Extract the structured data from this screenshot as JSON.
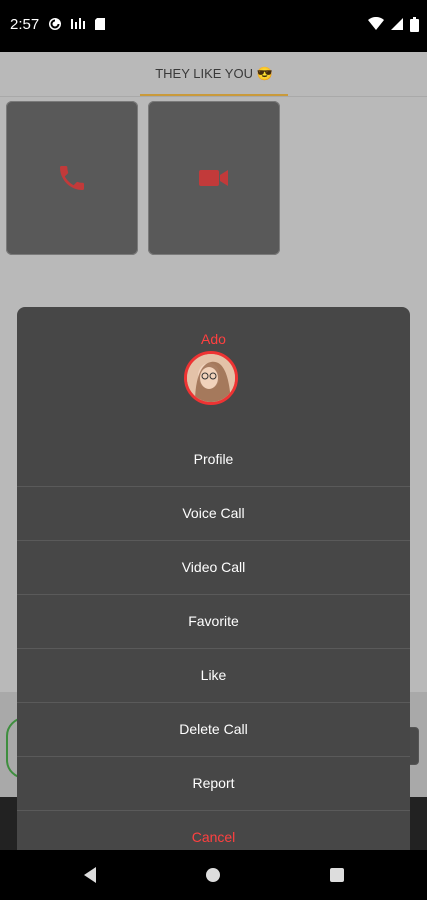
{
  "status": {
    "time": "2:57",
    "left_icons": [
      "pocket-casts-icon",
      "signal-bars-icon",
      "sim-card-icon"
    ],
    "right_icons": [
      "wifi-icon",
      "cell-signal-icon",
      "battery-icon"
    ]
  },
  "header": {
    "title": "THEY LIKE YOU 😎"
  },
  "tiles": {
    "voice_icon": "phone-icon",
    "video_icon": "video-camera-icon"
  },
  "sheet": {
    "name": "Ado",
    "menu_items": [
      "Profile",
      "Voice Call",
      "Video Call",
      "Favorite",
      "Like",
      "Delete Call",
      "Report"
    ],
    "cancel_label": "Cancel"
  },
  "colors": {
    "accent_red": "#ff4040",
    "tab_underline": "#c99a3b",
    "sheet_bg": "#474747"
  }
}
